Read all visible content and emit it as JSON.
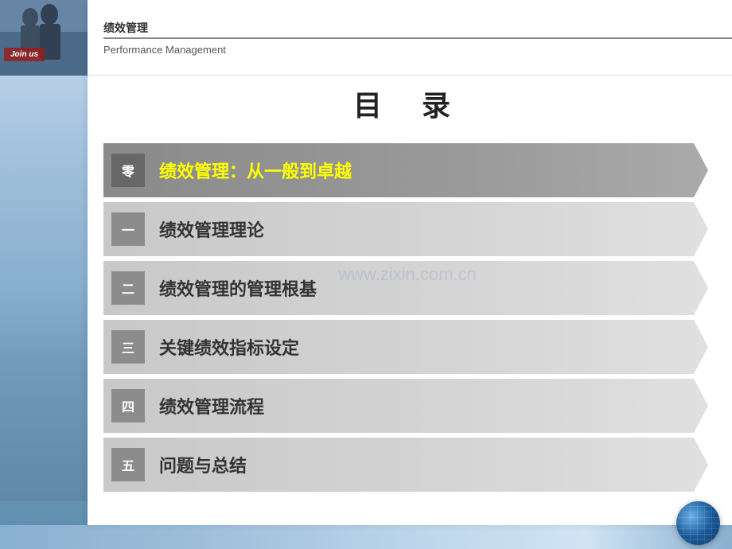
{
  "header": {
    "chinese_title": "绩效管理",
    "english_title": "Performance Management"
  },
  "main_title": "目    录",
  "watermark": "www.zixin.com.cn",
  "join_us": "Join us",
  "menu_items": [
    {
      "id": 1,
      "number_char": "零",
      "label": "绩效管理：从一般到卓越",
      "active": true
    },
    {
      "id": 2,
      "number_char": "一",
      "label": "绩效管理理论",
      "active": false
    },
    {
      "id": 3,
      "number_char": "二",
      "label": "绩效管理的管理根基",
      "active": false
    },
    {
      "id": 4,
      "number_char": "三",
      "label": "关键绩效指标设定",
      "active": false
    },
    {
      "id": 5,
      "number_char": "四",
      "label": "绩效管理流程",
      "active": false
    },
    {
      "id": 6,
      "number_char": "五",
      "label": "问题与总结",
      "active": false
    }
  ]
}
